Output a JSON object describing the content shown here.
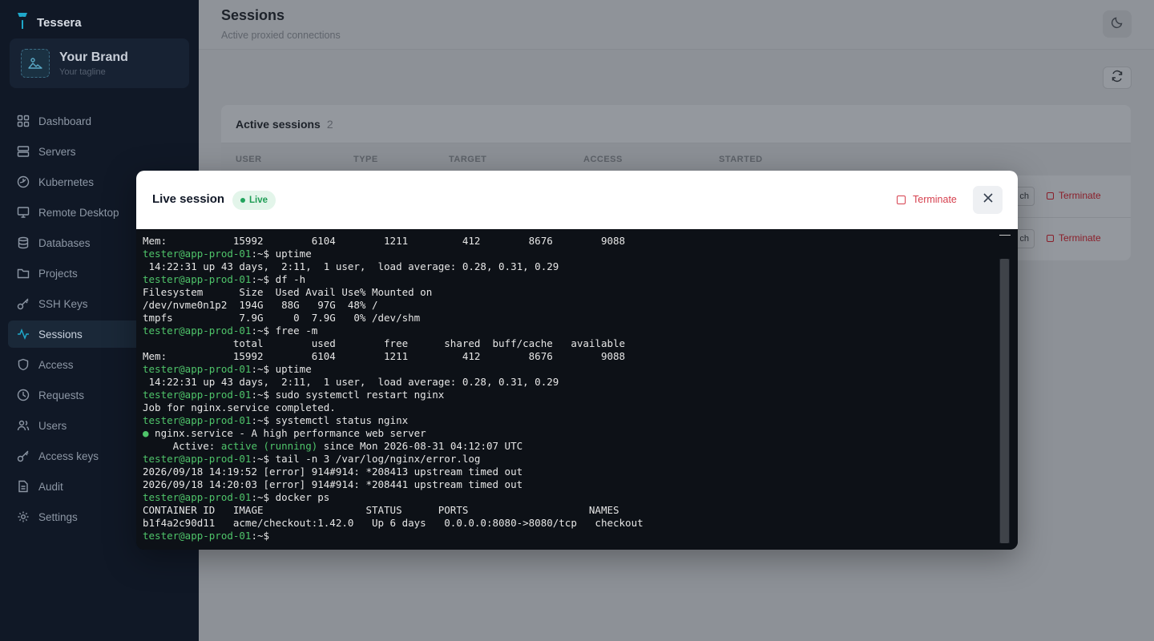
{
  "app": {
    "name": "Tessera"
  },
  "brand": {
    "name": "Your Brand",
    "tagline": "Your tagline"
  },
  "sidebar": {
    "items": [
      {
        "label": "Dashboard",
        "icon": "grid-icon"
      },
      {
        "label": "Servers",
        "icon": "server-icon"
      },
      {
        "label": "Kubernetes",
        "icon": "helm-icon"
      },
      {
        "label": "Remote Desktop",
        "icon": "monitor-icon"
      },
      {
        "label": "Databases",
        "icon": "database-icon"
      },
      {
        "label": "Projects",
        "icon": "folder-icon"
      },
      {
        "label": "SSH Keys",
        "icon": "key-icon"
      },
      {
        "label": "Sessions",
        "icon": "activity-icon",
        "active": true
      },
      {
        "label": "Access",
        "icon": "shield-icon"
      },
      {
        "label": "Requests",
        "icon": "clock-icon"
      },
      {
        "label": "Users",
        "icon": "users-icon"
      },
      {
        "label": "Access keys",
        "icon": "key-icon"
      },
      {
        "label": "Audit",
        "icon": "file-icon"
      },
      {
        "label": "Settings",
        "icon": "gear-icon"
      }
    ]
  },
  "header": {
    "title": "Sessions",
    "subtitle": "Active proxied connections"
  },
  "card": {
    "title": "Active sessions",
    "count": "2",
    "columns": [
      "USER",
      "TYPE",
      "TARGET",
      "ACCESS",
      "STARTED"
    ],
    "row_button_label": "ch",
    "row_terminate_label": "Terminate"
  },
  "modal": {
    "title": "Live session",
    "badge": "Live",
    "terminate_label": "Terminate"
  },
  "terminal": {
    "lines": [
      [
        {
          "t": "Mem:           15992        6104        1211         412        8676        9088"
        }
      ],
      [
        {
          "t": "tester@app-prod-01",
          "c": "prompt"
        },
        {
          "t": ":~$ uptime"
        }
      ],
      [
        {
          "t": " 14:22:31 up 43 days,  2:11,  1 user,  load average: 0.28, 0.31, 0.29"
        }
      ],
      [
        {
          "t": "tester@app-prod-01",
          "c": "prompt"
        },
        {
          "t": ":~$ df -h"
        }
      ],
      [
        {
          "t": "Filesystem      Size  Used Avail Use% Mounted on"
        }
      ],
      [
        {
          "t": "/dev/nvme0n1p2  194G   88G   97G  48% /"
        }
      ],
      [
        {
          "t": "tmpfs           7.9G     0  7.9G   0% /dev/shm"
        }
      ],
      [
        {
          "t": "tester@app-prod-01",
          "c": "prompt"
        },
        {
          "t": ":~$ free -m"
        }
      ],
      [
        {
          "t": "               total        used        free      shared  buff/cache   available"
        }
      ],
      [
        {
          "t": "Mem:           15992        6104        1211         412        8676        9088"
        }
      ],
      [
        {
          "t": "tester@app-prod-01",
          "c": "prompt"
        },
        {
          "t": ":~$ uptime"
        }
      ],
      [
        {
          "t": " 14:22:31 up 43 days,  2:11,  1 user,  load average: 0.28, 0.31, 0.29"
        }
      ],
      [
        {
          "t": "tester@app-prod-01",
          "c": "prompt"
        },
        {
          "t": ":~$ sudo systemctl restart nginx"
        }
      ],
      [
        {
          "t": "Job for nginx.service completed."
        }
      ],
      [
        {
          "t": "tester@app-prod-01",
          "c": "prompt"
        },
        {
          "t": ":~$ systemctl status nginx"
        }
      ],
      [
        {
          "t": "●",
          "c": "ok"
        },
        {
          "t": " nginx.service - A high performance web server"
        }
      ],
      [
        {
          "t": "     Active: "
        },
        {
          "t": "active (running)",
          "c": "ok"
        },
        {
          "t": " since Mon 2026-08-31 04:12:07 UTC"
        }
      ],
      [
        {
          "t": "tester@app-prod-01",
          "c": "prompt"
        },
        {
          "t": ":~$ tail -n 3 /var/log/nginx/error.log"
        }
      ],
      [
        {
          "t": "2026/09/18 14:19:52 [error] 914#914: *208413 upstream timed out"
        }
      ],
      [
        {
          "t": "2026/09/18 14:20:03 [error] 914#914: *208441 upstream timed out"
        }
      ],
      [
        {
          "t": "tester@app-prod-01",
          "c": "prompt"
        },
        {
          "t": ":~$ docker ps"
        }
      ],
      [
        {
          "t": "CONTAINER ID   IMAGE                 STATUS      PORTS                    NAMES"
        }
      ],
      [
        {
          "t": "b1f4a2c90d11   acme/checkout:1.42.0   Up 6 days   0.0.0.0:8080->8080/tcp   checkout"
        }
      ],
      [
        {
          "t": "tester@app-prod-01",
          "c": "prompt"
        },
        {
          "t": ":~$"
        }
      ]
    ]
  },
  "colors": {
    "sidebar_bg": "#101826",
    "accent": "#1fa7c9",
    "prompt_green": "#4fc46a",
    "danger": "#d6404e"
  }
}
